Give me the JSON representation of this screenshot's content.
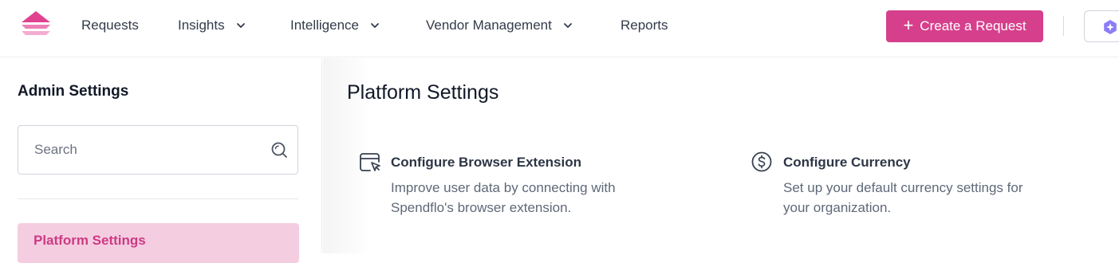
{
  "nav": {
    "items": [
      {
        "label": "Requests",
        "has_dropdown": false
      },
      {
        "label": "Insights",
        "has_dropdown": true
      },
      {
        "label": "Intelligence",
        "has_dropdown": true
      },
      {
        "label": "Vendor Management",
        "has_dropdown": true
      },
      {
        "label": "Reports",
        "has_dropdown": false
      }
    ],
    "create_button": {
      "label": "Create a Request",
      "icon": "plus-icon"
    },
    "ai_button": {
      "icon": "sparkle-icon"
    }
  },
  "sidebar": {
    "title": "Admin Settings",
    "search": {
      "placeholder": "Search",
      "value": ""
    },
    "items": [
      {
        "label": "Platform Settings",
        "active": true
      }
    ]
  },
  "main": {
    "title": "Platform Settings",
    "cards": [
      {
        "icon": "browser-cursor-icon",
        "title": "Configure Browser Extension",
        "description": "Improve user data by connecting with Spendflo's browser extension."
      },
      {
        "icon": "dollar-circle-icon",
        "title": "Configure Currency",
        "description": "Set up your default currency settings for your organization."
      }
    ]
  },
  "colors": {
    "brand": "#d63f8c",
    "active_bg": "#f5cde0",
    "active_text": "#cc3a84"
  }
}
